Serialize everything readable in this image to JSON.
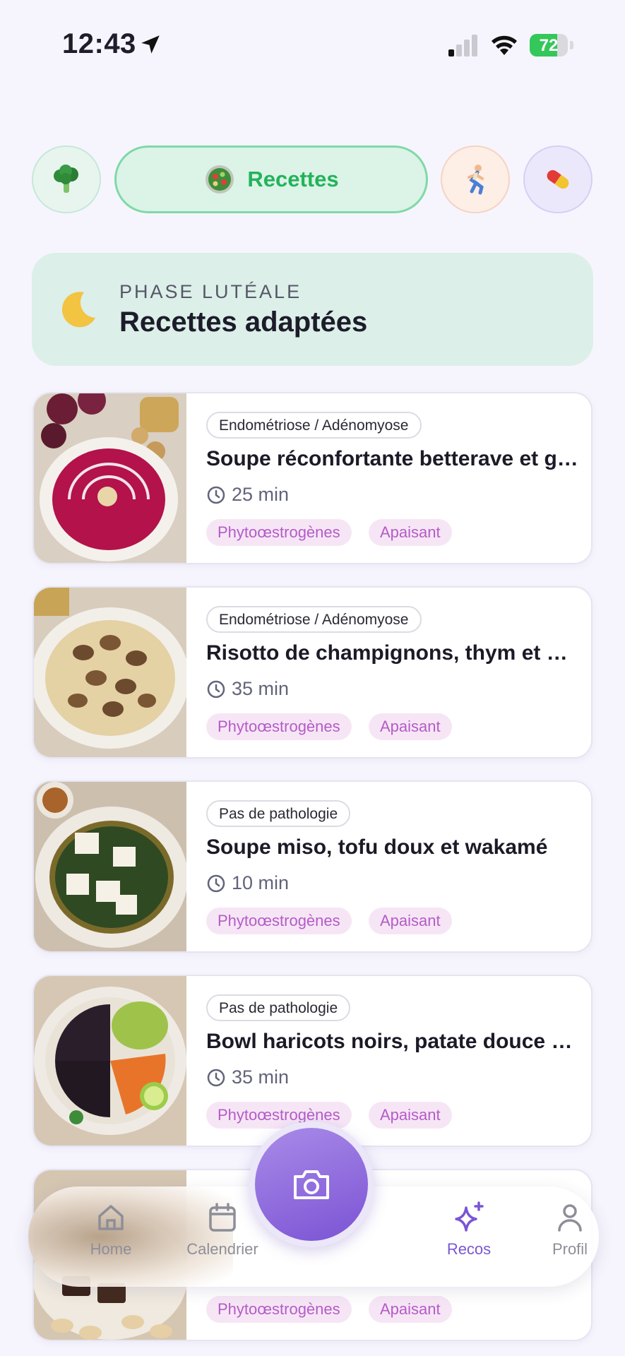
{
  "status_bar": {
    "time": "12:43",
    "battery": "72",
    "battery_level": 0.72
  },
  "categories": [
    {
      "icon": "broccoli-icon",
      "label": ""
    },
    {
      "icon": "salad-icon",
      "label": "Recettes",
      "selected": true
    },
    {
      "icon": "runner-icon",
      "label": ""
    },
    {
      "icon": "pill-icon",
      "label": ""
    }
  ],
  "phase_banner": {
    "icon": "moon-icon",
    "phase": "PHASE LUTÉALE",
    "title": "Recettes adaptées"
  },
  "recipes": [
    {
      "badge": "Endométriose / Adénomyose",
      "title": "Soupe réconfortante betterave et gingembre",
      "duration": "25 min",
      "tags": [
        "Phytoœstrogènes",
        "Apaisant"
      ],
      "image": "beet-soup"
    },
    {
      "badge": "Endométriose / Adénomyose",
      "title": "Risotto de champignons, thym et parmesan",
      "duration": "35 min",
      "tags": [
        "Phytoœstrogènes",
        "Apaisant"
      ],
      "image": "mushroom-risotto"
    },
    {
      "badge": "Pas de pathologie",
      "title": "Soupe miso, tofu doux et wakamé",
      "duration": "10 min",
      "tags": [
        "Phytoœstrogènes",
        "Apaisant"
      ],
      "image": "miso-soup"
    },
    {
      "badge": "Pas de pathologie",
      "title": "Bowl haricots noirs, patate douce et avocat",
      "duration": "35 min",
      "tags": [
        "Phytoœstrogènes",
        "Apaisant"
      ],
      "image": "black-bean-bowl"
    },
    {
      "badge": "",
      "title": "",
      "duration": "",
      "tags": [
        "Phytoœstrogènes",
        "Apaisant"
      ],
      "image": "chocolate-nuts"
    }
  ],
  "bottom_nav": {
    "items": [
      {
        "label": "Home",
        "icon": "home-icon"
      },
      {
        "label": "Calendrier",
        "icon": "calendar-icon"
      },
      {
        "label": "Recos",
        "icon": "sparkles-icon",
        "active": true
      },
      {
        "label": "Profil",
        "icon": "user-icon"
      }
    ],
    "camera": {
      "icon": "camera-icon"
    }
  },
  "colors": {
    "accent_green": "#23b35b",
    "accent_purple": "#7a56d3",
    "tag_text": "#b55bc9",
    "tag_bg": "#f6e6f5",
    "banner_bg": "#dcefe9"
  }
}
